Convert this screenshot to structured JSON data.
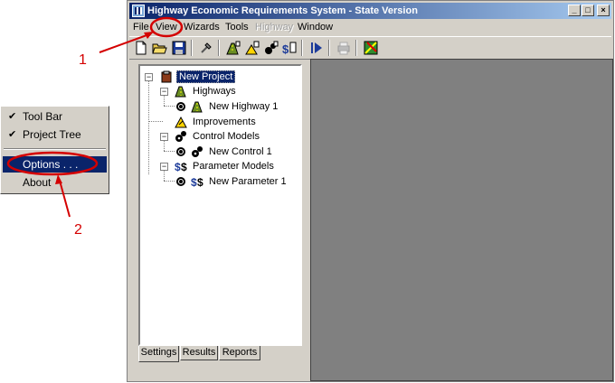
{
  "window": {
    "title": "Highway Economic Requirements System - State Version",
    "controls": {
      "minimize": "_",
      "maximize": "□",
      "close": "×"
    }
  },
  "menubar": {
    "items": [
      {
        "label": "File",
        "enabled": true
      },
      {
        "label": "View",
        "enabled": true
      },
      {
        "label": "Wizards",
        "enabled": true
      },
      {
        "label": "Tools",
        "enabled": true
      },
      {
        "label": "Highway",
        "enabled": false
      },
      {
        "label": "Window",
        "enabled": true
      }
    ]
  },
  "toolbar": {
    "buttons": [
      "new-icon",
      "open-icon",
      "save-icon",
      "tool-icon",
      "new-highway-icon",
      "new-improvement-icon",
      "new-control-icon",
      "new-parameter-icon",
      "run-icon",
      "print-icon",
      "map-icon"
    ]
  },
  "tree": {
    "root": "New Project",
    "highways": "Highways",
    "new_highway": "New Highway 1",
    "improvements": "Improvements",
    "control_models": "Control Models",
    "new_control": "New Control 1",
    "parameter_models": "Parameter Models",
    "new_parameter": "New Parameter 1"
  },
  "tabs": [
    {
      "label": "Settings",
      "active": true
    },
    {
      "label": "Results",
      "active": false
    },
    {
      "label": "Reports",
      "active": false
    }
  ],
  "popup_menu": {
    "items": [
      {
        "label": "Tool Bar",
        "checked": true,
        "highlighted": false
      },
      {
        "label": "Project Tree",
        "checked": true,
        "highlighted": false
      },
      {
        "label": "Options . . .",
        "checked": false,
        "highlighted": true
      },
      {
        "label": "About",
        "checked": false,
        "highlighted": false
      }
    ]
  },
  "annotations": {
    "step1": "1",
    "step2": "2",
    "color": "#d40000"
  },
  "colors": {
    "titlebar": "#0a246a",
    "selection": "#0a246a",
    "face": "#d4d0c8",
    "workspace": "#808080"
  }
}
